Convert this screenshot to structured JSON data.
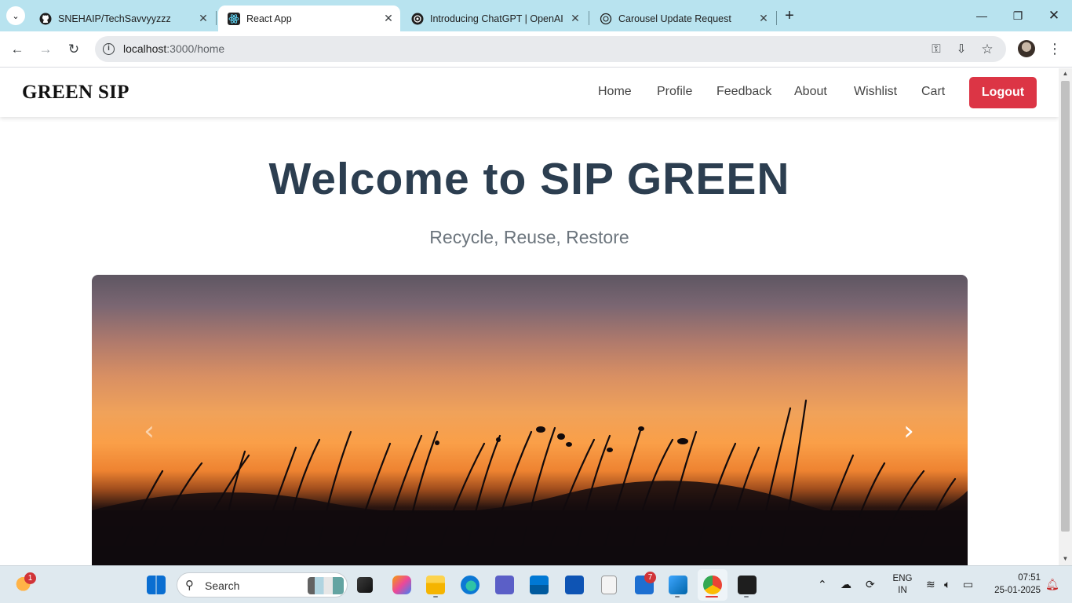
{
  "browser": {
    "tabs": [
      {
        "title": "SNEHAIP/TechSavvyyzzz",
        "icon": "github-icon",
        "active": false
      },
      {
        "title": "React App",
        "icon": "react-icon",
        "active": true
      },
      {
        "title": "Introducing ChatGPT | OpenAI",
        "icon": "openai-icon",
        "active": false
      },
      {
        "title": "Carousel Update Request",
        "icon": "openai-icon",
        "active": false
      }
    ],
    "url_host": "localhost",
    "url_path": ":3000/home"
  },
  "app": {
    "brand": "GREEN SIP",
    "nav": [
      "Home",
      "Profile",
      "Feedback",
      "About",
      "Wishlist",
      "Cart"
    ],
    "logout_label": "Logout",
    "hero_title": "Welcome to SIP GREEN",
    "hero_subtitle": "Recycle, Reuse, Restore",
    "carousel": {
      "image": "sunset-grass-silhouette",
      "prev_icon": "chevron-left-icon",
      "next_icon": "chevron-right-icon"
    },
    "colors": {
      "logout": "#dc3545",
      "title": "#2c3e50",
      "subtitle": "#6c757d"
    }
  },
  "taskbar": {
    "search_label": "Search",
    "weather_badge": "1",
    "teams_badge": "7",
    "lang_line1": "ENG",
    "lang_line2": "IN",
    "time": "07:51",
    "date": "25-01-2025"
  }
}
